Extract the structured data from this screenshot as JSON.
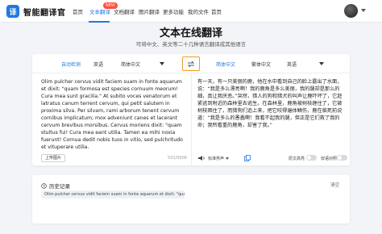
{
  "nav": {
    "logo_mark": "译",
    "logo_text": "智能翻译官",
    "items": [
      "首页",
      "文本翻译",
      "文档翻译",
      "图片翻译",
      "更多功能",
      "我的文件",
      "首页"
    ],
    "new_badge": "NEW"
  },
  "hero": {
    "title": "文本在线翻译",
    "subtitle": "可将中文、英文等二十几种语言翻译成其他语言"
  },
  "lang_bar": {
    "source_detect": "自动检测",
    "source_pick1": "英语",
    "source_pick2": "简体中文",
    "target_selected": "简体中文",
    "target_pick1": "繁体中文",
    "target_pick2": "英语"
  },
  "source": {
    "text": "Olim pulcher cervus vidit faciem suam in fonte aquarum et dixit: \"quam formosa est species cornuum meorum! Cura mea sunt gracilia.\" At subito voces venatorum et latratus canum terrent cervum, qui petit salutem in proxima silva. Per silvam, rami arborum tenent cervum cornibus implicatum; mox adveniunt canes et lacerant cervum brevibus morsibus. Cervus moriens dixit: \"quam stultus fui! Cura mea eant utilia. Tamen ea mihi noxia fuerunt! Cornua dedit nobis tuos in vitio, sed pulchritudo et vituperare utilia.",
    "upload_label": "上传图片",
    "counter": "531/5000"
  },
  "target": {
    "text": "有一天，有一只美丽的鹿，他在水中看到自己的脸上露出了水面，说：“我是多么漂亮啊！我的鹿角是多么美丽，我的腿却是那么的细，真让我厌恶。”突然，猎人的狗和猎犬的叫声让鹿吓坏了，它赶紧逃到附近的森林里去逃生。在森林里，鹿角被树枝缠住了，它被树枝困住了，而猎狗们追上来，把它咬得遍体鳞伤，鹿在临死前说道：“我是多么的愚蠢啊！我看不起我的腿，但正是它们救了我的命；我所看重的鹿角，却害了我。”",
    "voice_label": "标准男声",
    "toggle1_label": "原文高亮",
    "toggle2_label": "双语对照"
  },
  "history": {
    "title": "历史记录",
    "clear_label": "清空",
    "entries": [
      "Olim pulcher cervus vidit faciem suam in fonte aquarum et dixit: \"quam fo..."
    ]
  },
  "colors": {
    "accent": "#1f7ae0",
    "swap_border": "#f59a23",
    "badge": "#ff4d3a"
  }
}
